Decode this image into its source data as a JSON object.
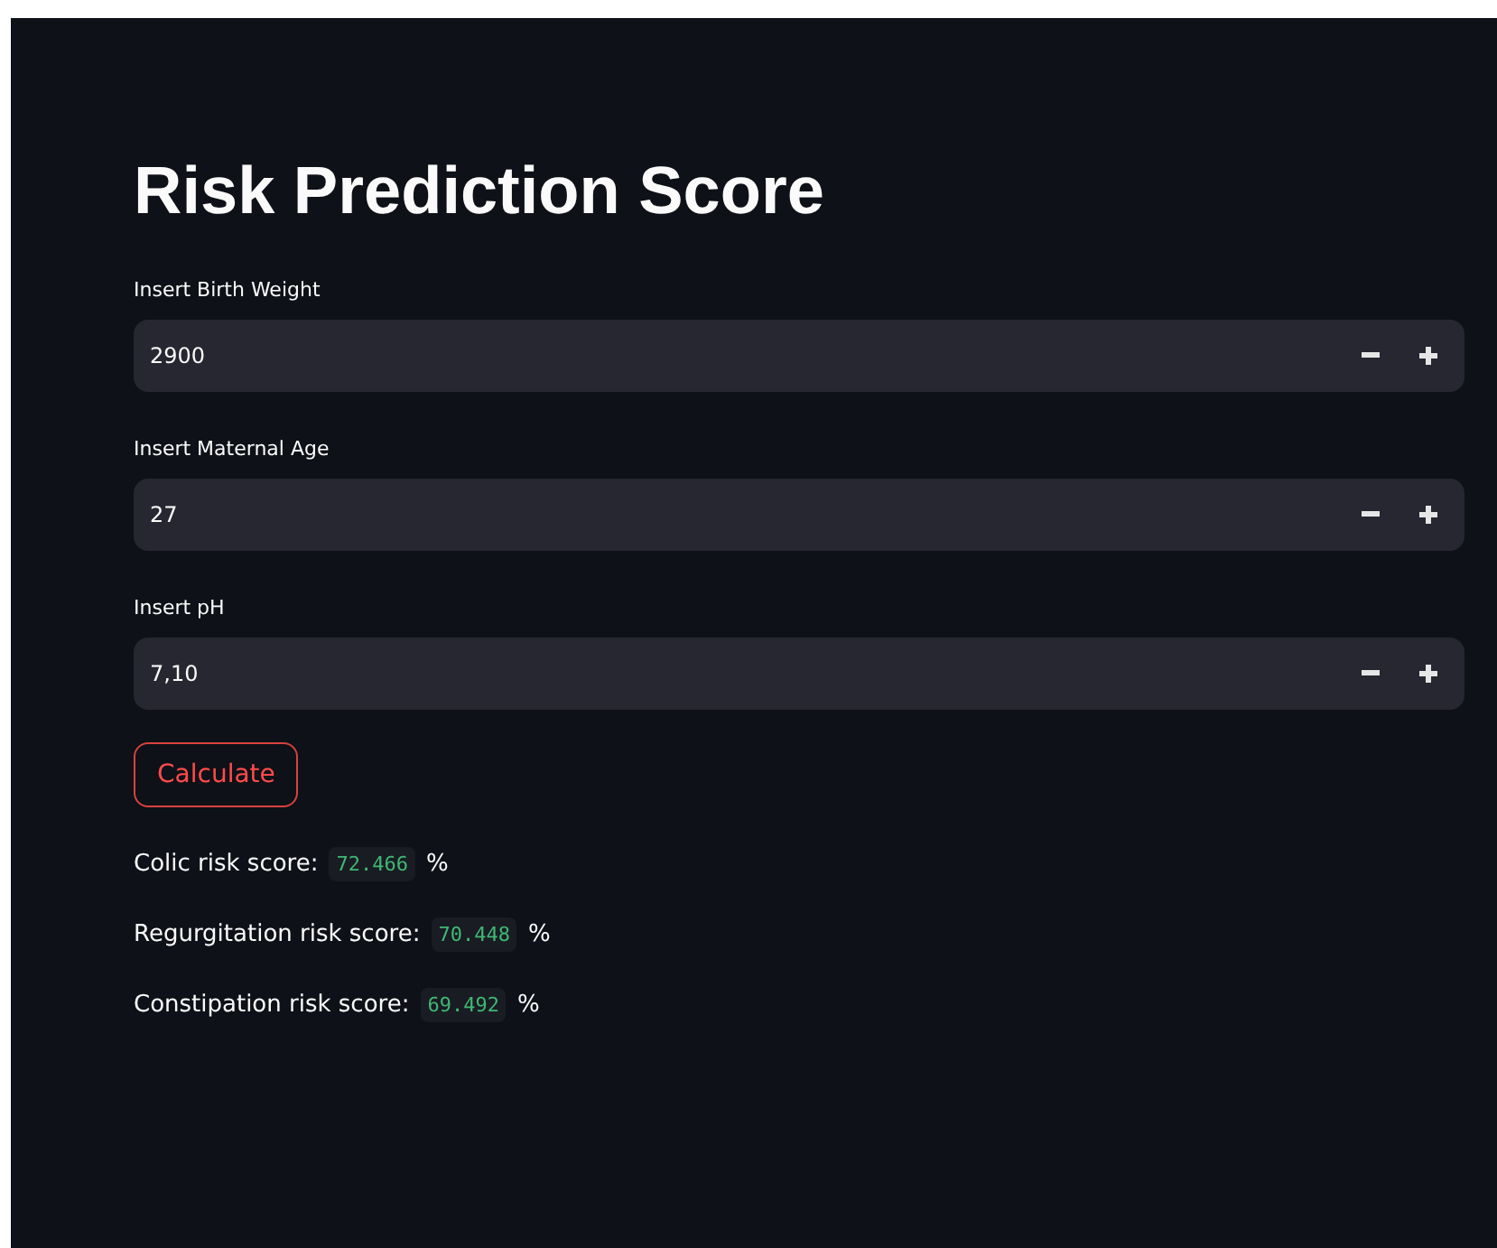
{
  "title": "Risk Prediction Score",
  "fields": [
    {
      "label": "Insert Birth Weight",
      "value": "2900"
    },
    {
      "label": "Insert Maternal Age",
      "value": "27"
    },
    {
      "label": "Insert pH",
      "value": "7,10"
    }
  ],
  "button": "Calculate",
  "results": [
    {
      "label": "Colic risk score:",
      "value": "72.466",
      "unit": "%"
    },
    {
      "label": "Regurgitation risk score:",
      "value": "70.448",
      "unit": "%"
    },
    {
      "label": "Constipation risk score:",
      "value": "69.492",
      "unit": "%"
    }
  ]
}
